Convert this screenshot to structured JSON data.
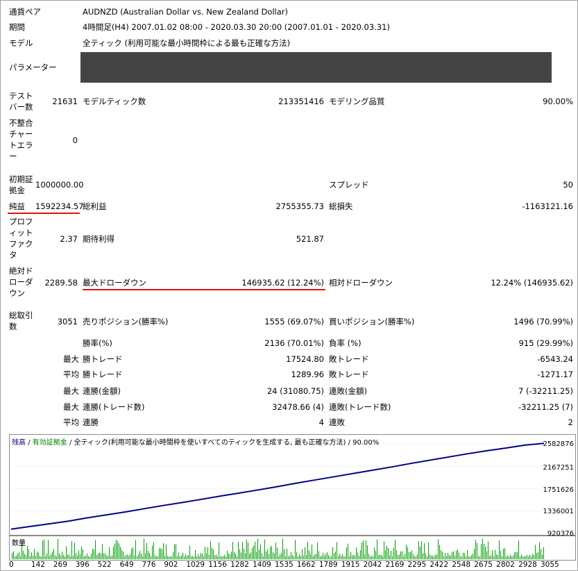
{
  "header": {
    "symbol_label": "通貨ペア",
    "symbol_value": "AUDNZD (Australian Dollar vs. New Zealand Dollar)",
    "period_label": "期間",
    "period_value": "4時間足(H4) 2007.01.02 08:00 - 2020.03.30 20:00 (2007.01.01 - 2020.03.31)",
    "model_label": "モデル",
    "model_value": "全ティック (利用可能な最小時間枠による最も正確な方法)",
    "parameters_label": "パラメーター"
  },
  "stats": {
    "test_bars": {
      "label": "テストバー数",
      "value": "21631"
    },
    "model_ticks": {
      "label": "モデルティック数",
      "value": "213351416"
    },
    "modeling_quality": {
      "label": "モデリング品質",
      "value": "90.00%"
    },
    "mismatch_errors": {
      "label": "不整合チャートエラー",
      "value": "0"
    },
    "initial_deposit": {
      "label": "初期証拠金",
      "value": "1000000.00"
    },
    "spread": {
      "label": "スプレッド",
      "value": "50"
    },
    "net_profit": {
      "label": "純益",
      "value": "1592234.57"
    },
    "gross_profit": {
      "label": "総利益",
      "value": "2755355.73"
    },
    "gross_loss": {
      "label": "総損失",
      "value": "-1163121.16"
    },
    "profit_factor": {
      "label": "プロフィットファクタ",
      "value": "2.37"
    },
    "expected_payoff": {
      "label": "期待利得",
      "value": "521.87"
    },
    "absolute_drawdown": {
      "label": "絶対ドローダウン",
      "value": "2289.58"
    },
    "maximal_drawdown": {
      "label": "最大ドローダウン",
      "value": "146935.62 (12.24%)"
    },
    "relative_drawdown": {
      "label": "相対ドローダウン",
      "value": "12.24% (146935.62)"
    },
    "total_trades": {
      "label": "総取引数",
      "value": "3051"
    },
    "short_positions": {
      "label": "売りポジション(勝率%)",
      "value": "1555 (69.07%)"
    },
    "long_positions": {
      "label": "買いポジション(勝率%)",
      "value": "1496 (70.99%)"
    },
    "profit_trades": {
      "label": "勝率(%)",
      "value": "2136 (70.01%)"
    },
    "loss_trades": {
      "label": "負率 (%)",
      "value": "915 (29.99%)"
    },
    "largest": {
      "prefix": "最大",
      "profit_label": "勝トレード",
      "profit_value": "17524.80",
      "loss_label": "敗トレード",
      "loss_value": "-6543.24"
    },
    "average": {
      "prefix": "平均",
      "profit_label": "勝トレード",
      "profit_value": "1289.96",
      "loss_label": "敗トレード",
      "loss_value": "-1271.17"
    },
    "max_consec_money": {
      "prefix": "最大",
      "wins_label": "連勝(金額)",
      "wins_value": "24 (31080.75)",
      "losses_label": "連敗(金額)",
      "losses_value": "7 (-32211.25)"
    },
    "maximal_consec": {
      "prefix": "最大",
      "profit_label": "連勝(トレード数)",
      "profit_value": "32478.66 (4)",
      "loss_label": "連敗(トレード数)",
      "loss_value": "-32211.25 (7)"
    },
    "average_consec": {
      "prefix": "平均",
      "wins_label": "連勝",
      "wins_value": "4",
      "losses_label": "連敗",
      "losses_value": "2"
    }
  },
  "chart": {
    "caption_balance": "残高",
    "caption_sep": " / ",
    "caption_equity": "有効証拠金",
    "caption_model": "全ティック(利用可能な最小時間枠を使いすべてのティックを生成する, 最も正確な方法)",
    "caption_quality": "90.00%",
    "volume_label": "数量",
    "colors": {
      "balance": "#00008b",
      "volume": "#00a000",
      "grid": "#d8d8d8"
    }
  },
  "chart_data": {
    "type": "line",
    "series": [
      {
        "values": [
          1000000,
          1050000,
          1100000,
          1150000,
          1210000,
          1265000,
          1320000,
          1380000,
          1440000,
          1495000,
          1555000,
          1615000,
          1670000,
          1730000,
          1790000,
          1855000,
          1915000,
          1975000,
          2035000,
          2095000,
          2155000,
          2220000,
          2280000,
          2340000,
          2400000,
          2455000,
          2505000,
          2560000,
          2592000
        ]
      }
    ],
    "x_start": 0,
    "x_end": 3051,
    "ylim": [
      920376,
      2582876
    ],
    "y_ticks": [
      "2582876",
      "2167251",
      "1751626",
      "1336001",
      "920376"
    ],
    "x_ticks": [
      "0",
      "142",
      "269",
      "396",
      "522",
      "649",
      "776",
      "902",
      "1029",
      "1156",
      "1282",
      "1409",
      "1535",
      "1662",
      "1789",
      "1915",
      "2042",
      "2169",
      "2295",
      "2422",
      "2548",
      "2675",
      "2802",
      "2928",
      "3055"
    ]
  }
}
